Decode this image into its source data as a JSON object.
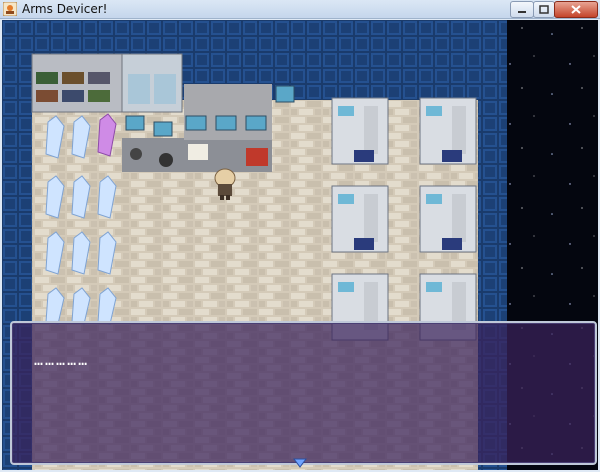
{
  "window": {
    "title": "Arms Devicer!"
  },
  "controls": [
    "minimize",
    "maximize",
    "close"
  ],
  "message": {
    "text": "……………"
  },
  "icons": [
    "app-icon",
    "minimize-icon",
    "maximize-icon",
    "close-icon",
    "message-continue-arrow-icon"
  ],
  "colors": {
    "floor": "#cfc6b4",
    "wall": "#1d3f73",
    "message_window": "#3a225c",
    "space": "#050818"
  }
}
